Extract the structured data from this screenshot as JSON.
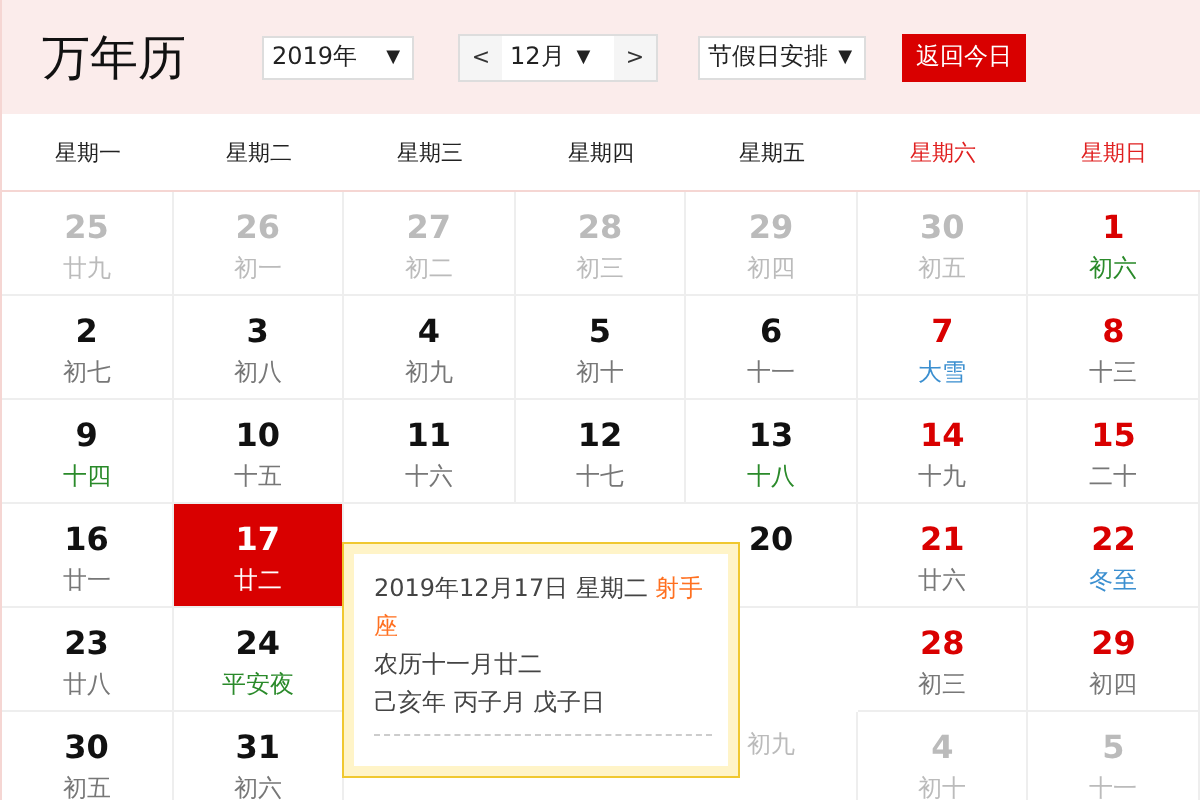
{
  "title": "万年历",
  "controls": {
    "year": {
      "value": "2019年",
      "arrow": "▼"
    },
    "month": {
      "prev": "<",
      "value": "12月",
      "arrow": "▼",
      "next": ">"
    },
    "holiday": {
      "value": "节假日安排",
      "arrow": "▼"
    },
    "today_button": "返回今日"
  },
  "weekdays": [
    {
      "label": "星期一",
      "weekend": false
    },
    {
      "label": "星期二",
      "weekend": false
    },
    {
      "label": "星期三",
      "weekend": false
    },
    {
      "label": "星期四",
      "weekend": false
    },
    {
      "label": "星期五",
      "weekend": false
    },
    {
      "label": "星期六",
      "weekend": true
    },
    {
      "label": "星期日",
      "weekend": true
    }
  ],
  "weeks": [
    {
      "mon": {
        "day": "25",
        "lunar": "廿九",
        "muted": true,
        "kind": "plain",
        "selected": false
      },
      "tue": {
        "day": "26",
        "lunar": "初一",
        "muted": true,
        "kind": "plain",
        "selected": false
      },
      "wed": {
        "day": "27",
        "lunar": "初二",
        "muted": true,
        "kind": "plain",
        "selected": false
      },
      "thu": {
        "day": "28",
        "lunar": "初三",
        "muted": true,
        "kind": "plain",
        "selected": false
      },
      "fri": {
        "day": "29",
        "lunar": "初四",
        "muted": true,
        "kind": "plain",
        "selected": false
      },
      "sat": {
        "day": "30",
        "lunar": "初五",
        "muted": true,
        "kind": "plain",
        "selected": false
      },
      "sun": {
        "day": "1",
        "lunar": "初六",
        "muted": false,
        "kind": "festival",
        "selected": false
      }
    },
    {
      "mon": {
        "day": "2",
        "lunar": "初七",
        "muted": false,
        "kind": "plain",
        "selected": false
      },
      "tue": {
        "day": "3",
        "lunar": "初八",
        "muted": false,
        "kind": "plain",
        "selected": false
      },
      "wed": {
        "day": "4",
        "lunar": "初九",
        "muted": false,
        "kind": "plain",
        "selected": false
      },
      "thu": {
        "day": "5",
        "lunar": "初十",
        "muted": false,
        "kind": "plain",
        "selected": false
      },
      "fri": {
        "day": "6",
        "lunar": "十一",
        "muted": false,
        "kind": "plain",
        "selected": false
      },
      "sat": {
        "day": "7",
        "lunar": "大雪",
        "muted": false,
        "kind": "term",
        "selected": false
      },
      "sun": {
        "day": "8",
        "lunar": "十三",
        "muted": false,
        "kind": "plain",
        "selected": false
      }
    },
    {
      "mon": {
        "day": "9",
        "lunar": "十四",
        "muted": false,
        "kind": "festival",
        "selected": false
      },
      "tue": {
        "day": "10",
        "lunar": "十五",
        "muted": false,
        "kind": "plain",
        "selected": false
      },
      "wed": {
        "day": "11",
        "lunar": "十六",
        "muted": false,
        "kind": "plain",
        "selected": false
      },
      "thu": {
        "day": "12",
        "lunar": "十七",
        "muted": false,
        "kind": "plain",
        "selected": false
      },
      "fri": {
        "day": "13",
        "lunar": "十八",
        "muted": false,
        "kind": "festival",
        "selected": false
      },
      "sat": {
        "day": "14",
        "lunar": "十九",
        "muted": false,
        "kind": "plain",
        "selected": false
      },
      "sun": {
        "day": "15",
        "lunar": "二十",
        "muted": false,
        "kind": "plain",
        "selected": false
      }
    },
    {
      "mon": {
        "day": "16",
        "lunar": "廿一",
        "muted": false,
        "kind": "plain",
        "selected": false
      },
      "tue": {
        "day": "17",
        "lunar": "廿二",
        "muted": false,
        "kind": "plain",
        "selected": true
      },
      "fri": {
        "day": "20",
        "muted": false,
        "selected": false
      },
      "sat": {
        "day": "21",
        "lunar": "廿六",
        "muted": false,
        "kind": "plain",
        "selected": false
      },
      "sun": {
        "day": "22",
        "lunar": "冬至",
        "muted": false,
        "kind": "term",
        "selected": false
      }
    },
    {
      "mon": {
        "day": "23",
        "lunar": "廿八",
        "muted": false,
        "kind": "plain",
        "selected": false
      },
      "tue": {
        "day": "24",
        "lunar": "平安夜",
        "muted": false,
        "kind": "festival",
        "selected": false
      },
      "sat": {
        "day": "28",
        "lunar": "初三",
        "muted": false,
        "kind": "plain",
        "selected": false
      },
      "sun": {
        "day": "29",
        "lunar": "初四",
        "muted": false,
        "kind": "plain",
        "selected": false
      }
    },
    {
      "mon": {
        "day": "30",
        "lunar": "初五",
        "muted": false,
        "kind": "plain",
        "selected": false
      },
      "tue": {
        "day": "31",
        "lunar": "初六",
        "muted": false,
        "kind": "plain",
        "selected": false
      },
      "fri": {
        "lunar": "初九",
        "muted": true,
        "kind": "plain"
      },
      "sat": {
        "day": "4",
        "lunar": "初十",
        "muted": true,
        "kind": "plain",
        "selected": false
      },
      "sun": {
        "day": "5",
        "lunar": "十一",
        "muted": true,
        "kind": "plain",
        "selected": false
      }
    }
  ],
  "tooltip": {
    "date": "2019年12月17日 星期二",
    "zodiac": "射手座",
    "lunar": "农历十一月廿二",
    "ganzhi": "己亥年 丙子月 戊子日"
  }
}
